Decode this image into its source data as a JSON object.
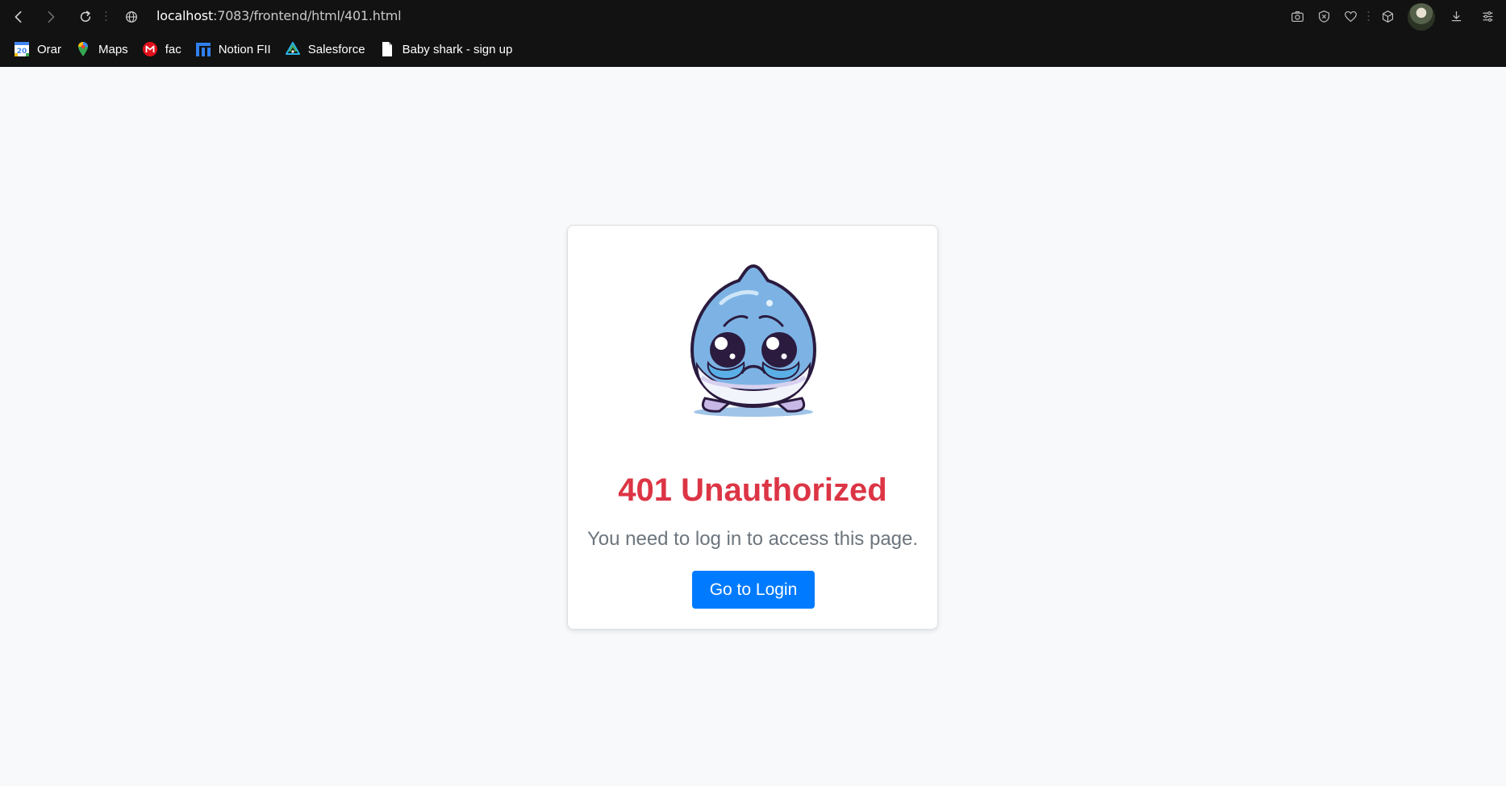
{
  "browser": {
    "url_host": "localhost",
    "url_path": ":7083/frontend/html/401.html",
    "bookmarks": [
      {
        "label": "Orar",
        "icon": "calendar-icon"
      },
      {
        "label": "Maps",
        "icon": "maps-pin-icon"
      },
      {
        "label": "fac",
        "icon": "mail-icon"
      },
      {
        "label": "Notion FII",
        "icon": "notion-icon"
      },
      {
        "label": "Salesforce",
        "icon": "salesforce-icon"
      },
      {
        "label": "Baby shark - sign up",
        "icon": "document-icon"
      }
    ],
    "calendar_day": "20"
  },
  "page": {
    "title": "401 Unauthorized",
    "message": "You need to log in to access this page.",
    "login_button": "Go to Login",
    "colors": {
      "title": "#dc3545",
      "message": "#6c757d",
      "button": "#007bff",
      "background": "#f8f9fa"
    }
  }
}
